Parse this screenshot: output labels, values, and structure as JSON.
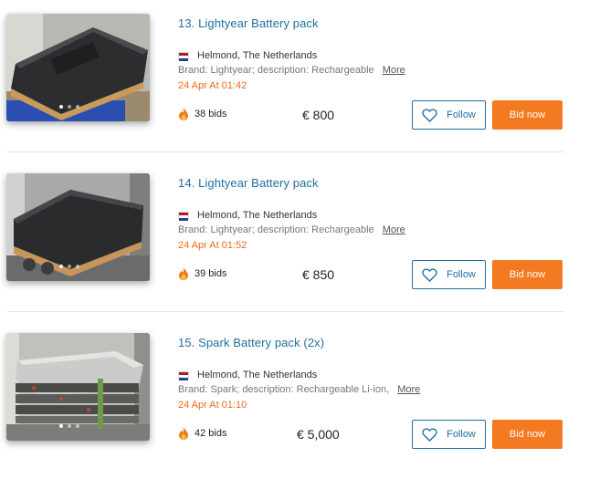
{
  "lots": [
    {
      "title": "13. Lightyear Battery pack",
      "location": "Helmond, The Netherlands",
      "description": "Brand: Lightyear; description: Rechargeable",
      "more_label": "More",
      "closing": "24 Apr At 01:42",
      "bids": "38 bids",
      "price": "€ 800",
      "follow_label": "Follow",
      "bid_label": "Bid now",
      "flag_icon": "netherlands-flag-icon",
      "photo_slides": 3
    },
    {
      "title": "14. Lightyear Battery pack",
      "location": "Helmond, The Netherlands",
      "description": "Brand: Lightyear; description: Rechargeable",
      "more_label": "More",
      "closing": "24 Apr At 01:52",
      "bids": "39 bids",
      "price": "€ 850",
      "follow_label": "Follow",
      "bid_label": "Bid now",
      "flag_icon": "netherlands-flag-icon",
      "photo_slides": 3
    },
    {
      "title": "15. Spark Battery pack (2x)",
      "location": "Helmond, The Netherlands",
      "description": "Brand: Spark; description: Rechargeable Li-ion,",
      "more_label": "More",
      "closing": "24 Apr At 01:10",
      "bids": "42 bids",
      "price": "€ 5,000",
      "follow_label": "Follow",
      "bid_label": "Bid now",
      "flag_icon": "netherlands-flag-icon",
      "photo_slides": 3
    }
  ],
  "colors": {
    "title": "#1f6f9f",
    "date": "#f06a1c",
    "bid_button": "#f47a22",
    "follow_border": "#1f6f9f",
    "flag_red": "#ae1c28",
    "flag_white": "#ffffff",
    "flag_blue": "#21468b"
  },
  "icons": {
    "bids": "flame-icon",
    "follow": "heart-outline-icon"
  }
}
